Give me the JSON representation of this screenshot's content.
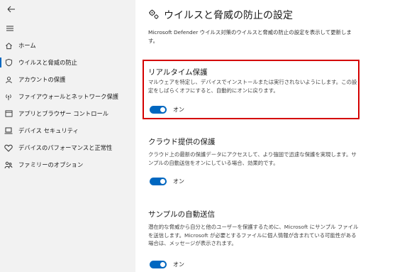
{
  "sidebar": {
    "back_icon": "back-arrow-icon",
    "menu_icon": "hamburger-icon",
    "items": [
      {
        "label": "ホーム",
        "icon": "home-icon"
      },
      {
        "label": "ウイルスと脅威の防止",
        "icon": "shield-icon",
        "active": true
      },
      {
        "label": "アカウントの保護",
        "icon": "person-icon"
      },
      {
        "label": "ファイアウォールとネットワーク保護",
        "icon": "antenna-icon"
      },
      {
        "label": "アプリとブラウザー コントロール",
        "icon": "app-window-icon"
      },
      {
        "label": "デバイス セキュリティ",
        "icon": "laptop-icon"
      },
      {
        "label": "デバイスのパフォーマンスと正常性",
        "icon": "heart-icon"
      },
      {
        "label": "ファミリーのオプション",
        "icon": "family-icon"
      }
    ]
  },
  "main": {
    "title": "ウイルスと脅威の防止の設定",
    "title_icon": "gears-icon",
    "description": "Microsoft Defender ウイルス対策のウイルスと脅威の防止の設定を表示して更新します。",
    "sections": [
      {
        "title": "リアルタイム保護",
        "description": "マルウェアを特定し、デバイスでインストールまたは実行されないようにします。この設定をしばらくオフにすると、自動的にオンに戻ります。",
        "toggle_label": "オン",
        "toggle_on": true,
        "highlighted": true
      },
      {
        "title": "クラウド提供の保護",
        "description": "クラウド上の最新の保護データにアクセスして、より強固で迅速な保護を実現します。サンプルの自動送信をオンにしている場合、効果的です。",
        "toggle_label": "オン",
        "toggle_on": true
      },
      {
        "title": "サンプルの自動送信",
        "description": "潜在的な脅威から自分と他のユーザーを保護するために、Microsoft にサンプル ファイルを送信します。Microsoft が必要とするファイルに個人情報が含まれている可能性がある場合は、メッセージが表示されます。",
        "toggle_label": "オン",
        "toggle_on": true
      }
    ]
  },
  "colors": {
    "accent": "#0067c0",
    "highlight_border": "#d40000",
    "sidebar_bg": "#f2f2f2"
  }
}
